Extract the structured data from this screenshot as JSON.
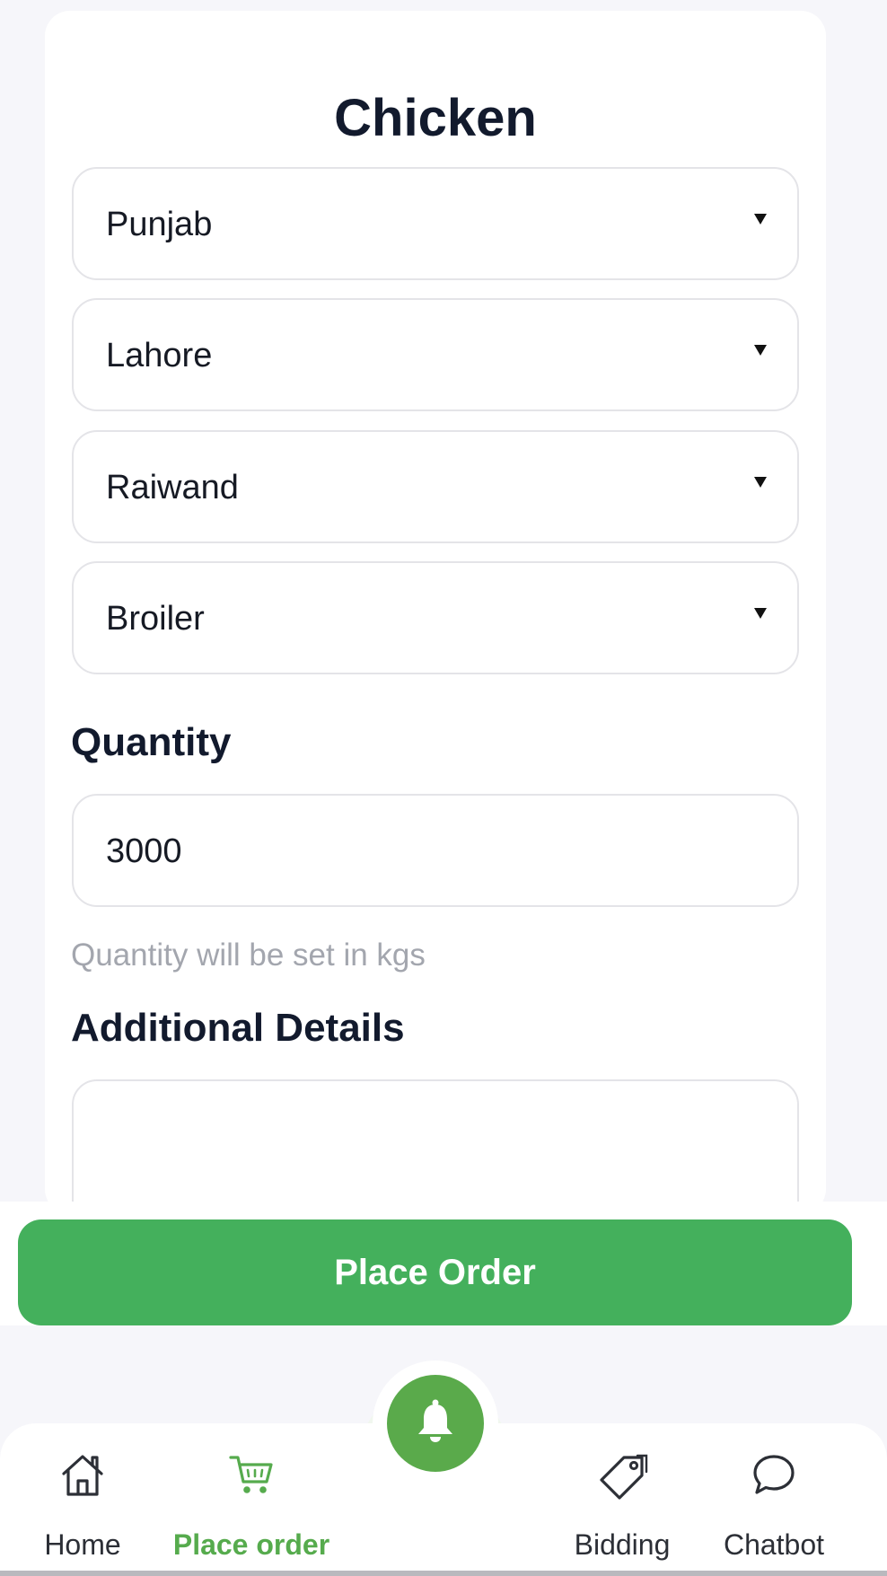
{
  "form": {
    "title": "Chicken",
    "selects": [
      {
        "value": "Punjab"
      },
      {
        "value": "Lahore"
      },
      {
        "value": "Raiwand"
      },
      {
        "value": "Broiler"
      }
    ],
    "quantity": {
      "label": "Quantity",
      "value": "3000",
      "hint": "Quantity will be set in kgs"
    },
    "details": {
      "label": "Additional Details",
      "value": ""
    },
    "submit_label": "Place Order"
  },
  "nav": {
    "items": [
      {
        "label": "Home",
        "icon": "home-icon"
      },
      {
        "label": "Place order",
        "icon": "cart-icon",
        "active": true
      },
      {
        "label": "Bidding",
        "icon": "tag-icon"
      },
      {
        "label": "Chatbot",
        "icon": "chat-bubble-icon"
      }
    ],
    "fab_icon": "bell-icon"
  },
  "colors": {
    "primary": "#44b05c",
    "active_nav": "#56ab4d",
    "fab": "#5aaa4b",
    "background": "#f6f6fa",
    "hint": "#a3a6ae"
  }
}
